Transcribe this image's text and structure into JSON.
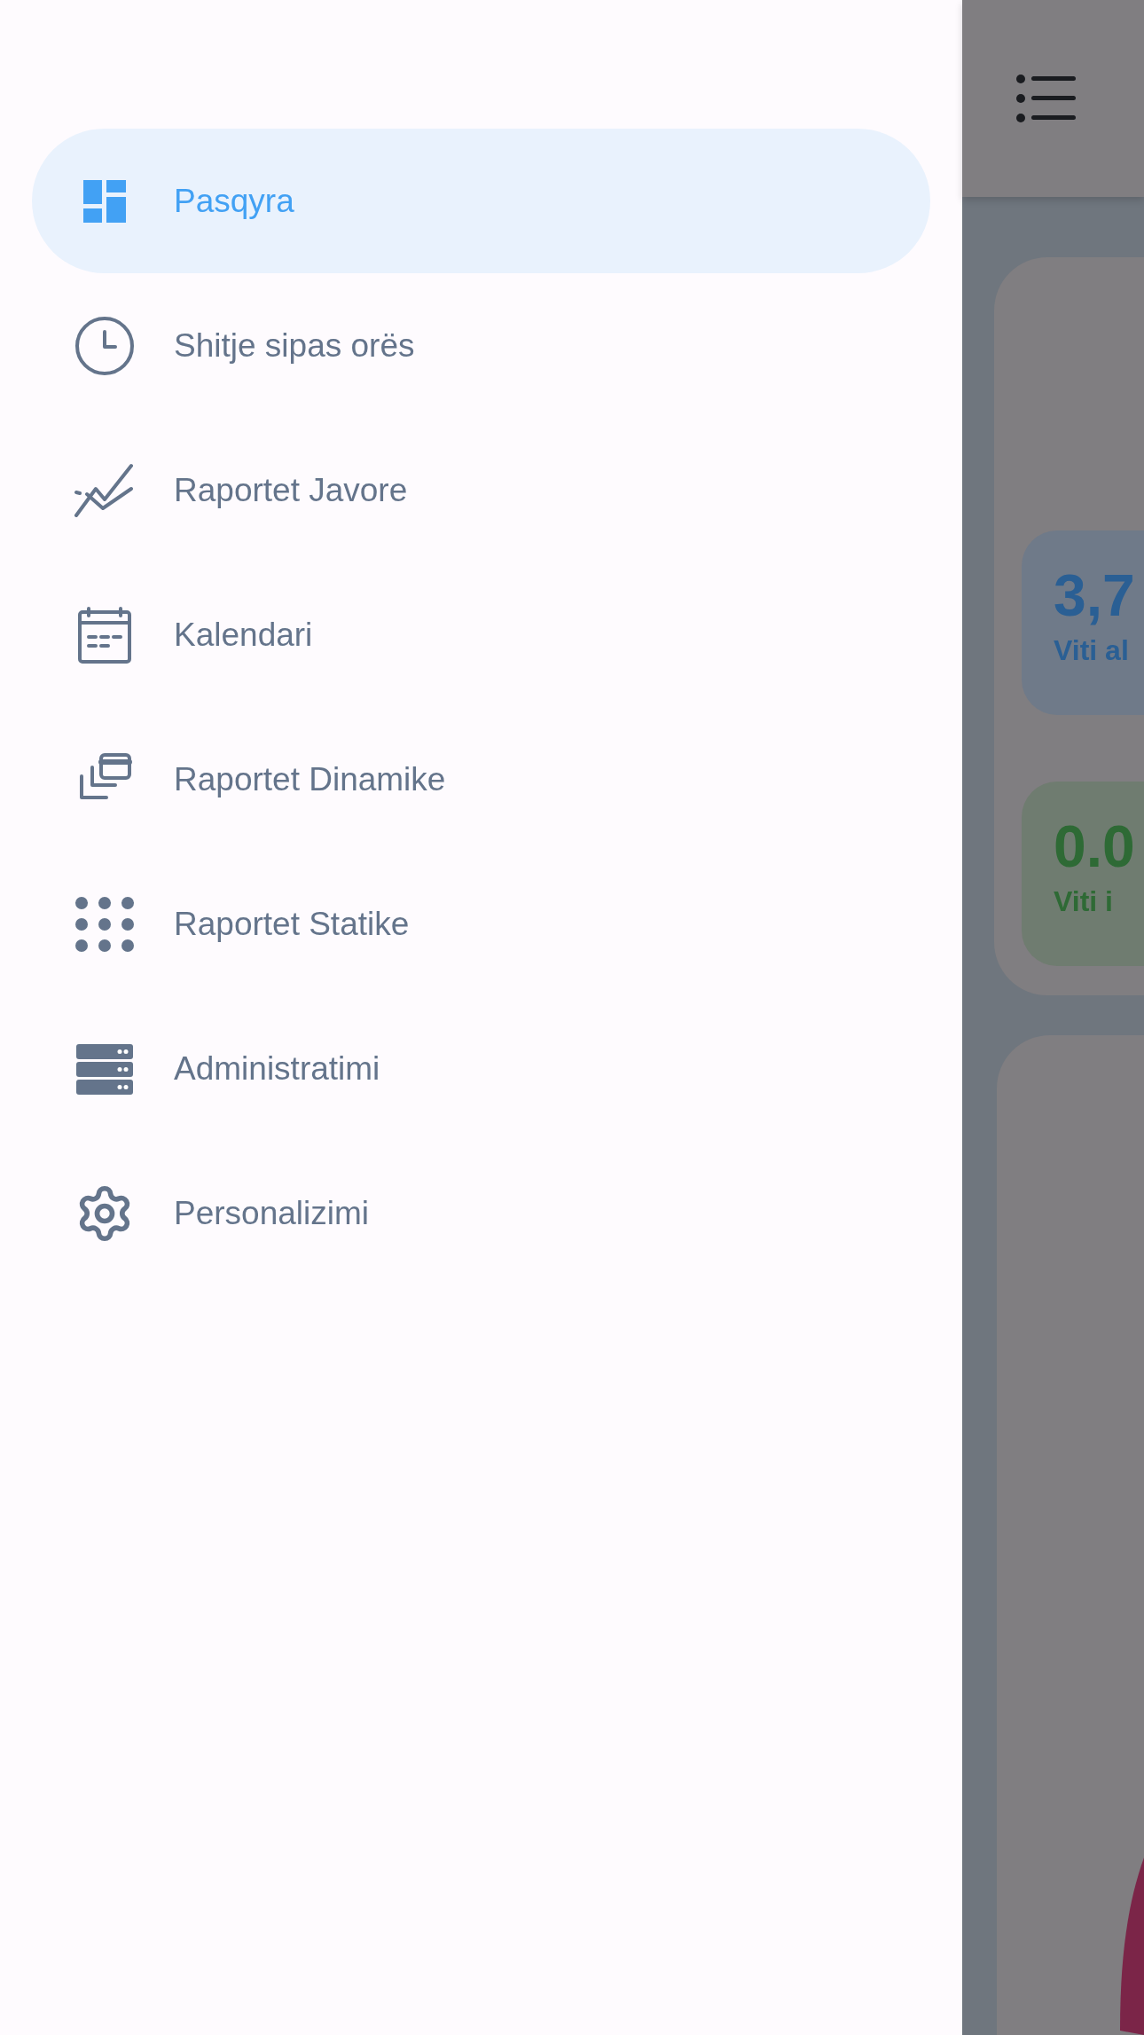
{
  "drawer": {
    "items": [
      {
        "label": "Pasqyra",
        "selected": true
      },
      {
        "label": "Shitje sipas orës",
        "selected": false
      },
      {
        "label": "Raportet Javore",
        "selected": false
      },
      {
        "label": "Kalendari",
        "selected": false
      },
      {
        "label": "Raportet Dinamike",
        "selected": false
      },
      {
        "label": "Raportet Statike",
        "selected": false
      },
      {
        "label": "Administratimi",
        "selected": false
      },
      {
        "label": "Personalizimi",
        "selected": false
      }
    ]
  },
  "background": {
    "stats": [
      {
        "value": "3,7",
        "label": "Viti al",
        "kind": "blue"
      },
      {
        "value": "0.0",
        "label": "Viti i",
        "kind": "green"
      }
    ]
  }
}
